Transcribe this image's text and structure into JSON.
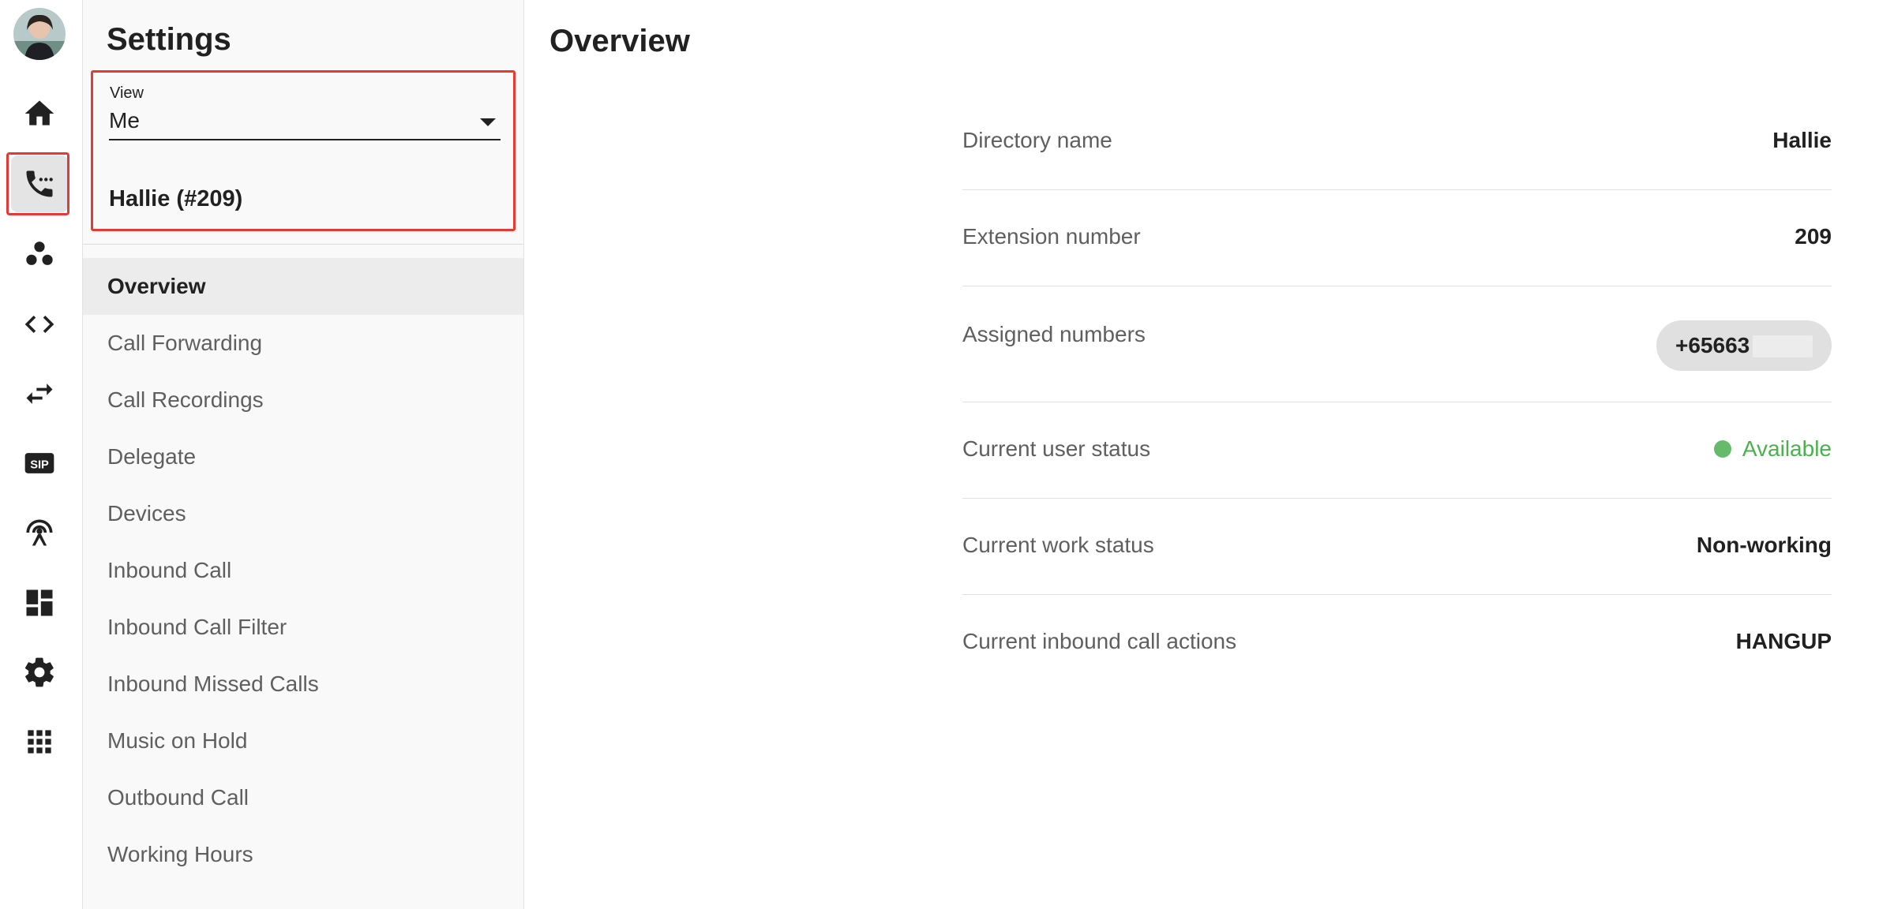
{
  "colors": {
    "highlight": "#e53935",
    "status_available": "#4caf50",
    "active_menu_bg": "#ececec"
  },
  "rail": {
    "items": [
      {
        "icon": "home-icon"
      },
      {
        "icon": "phone-dots-icon",
        "active": true
      },
      {
        "icon": "people-group-icon"
      },
      {
        "icon": "code-brackets-icon"
      },
      {
        "icon": "swap-arrows-icon"
      },
      {
        "icon": "sip-icon",
        "text": "SIP"
      },
      {
        "icon": "broadcast-antenna-icon"
      },
      {
        "icon": "dashboard-icon"
      },
      {
        "icon": "settings-gear-icon"
      },
      {
        "icon": "apps-grid-icon"
      }
    ]
  },
  "panel": {
    "title": "Settings",
    "view": {
      "label": "View",
      "value": "Me"
    },
    "user": "Hallie (#209)",
    "menu": [
      {
        "label": "Overview",
        "active": true
      },
      {
        "label": "Call Forwarding"
      },
      {
        "label": "Call Recordings"
      },
      {
        "label": "Delegate"
      },
      {
        "label": "Devices"
      },
      {
        "label": "Inbound Call"
      },
      {
        "label": "Inbound Call Filter"
      },
      {
        "label": "Inbound Missed Calls"
      },
      {
        "label": "Music on Hold"
      },
      {
        "label": "Outbound Call"
      },
      {
        "label": "Working Hours"
      }
    ]
  },
  "main": {
    "title": "Overview",
    "rows": [
      {
        "label": "Directory name",
        "value": "Hallie"
      },
      {
        "label": "Extension number",
        "value": "209"
      },
      {
        "label": "Assigned numbers",
        "value": "+65663"
      },
      {
        "label": "Current user status",
        "value": "Available"
      },
      {
        "label": "Current work status",
        "value": "Non-working"
      },
      {
        "label": "Current inbound call actions",
        "value": "HANGUP"
      }
    ]
  }
}
